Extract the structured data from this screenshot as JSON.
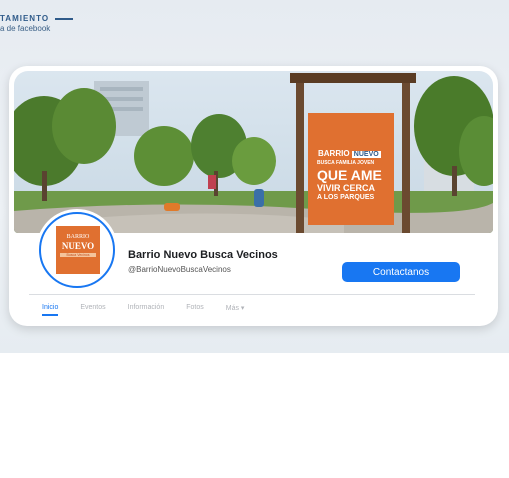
{
  "caption": {
    "line1": "TAMIENTO",
    "line2": "a de facebook"
  },
  "cover_sign": {
    "brand_left": "BARRIO",
    "brand_right": "NUEVO",
    "line1": "BUSCA FAMILIA JOVEN",
    "line2": "QUE AME",
    "line3": "VIVIR CERCA",
    "line4": "A LOS PARQUES"
  },
  "avatar_logo": {
    "top": "BARRIO",
    "main": "NUEVO",
    "sub": "Busca Vecinos"
  },
  "profile": {
    "name": "Barrio Nuevo Busca Vecinos",
    "handle": "@BarrioNuevoBuscaVecinos"
  },
  "contact_button": "Contactanos",
  "tabs": [
    "Inicio",
    "Eventos",
    "Información",
    "Fotos",
    "Más ▾"
  ],
  "colors": {
    "accent": "#1877f2",
    "sign_orange": "#e07030",
    "background": "#e9eef3"
  }
}
